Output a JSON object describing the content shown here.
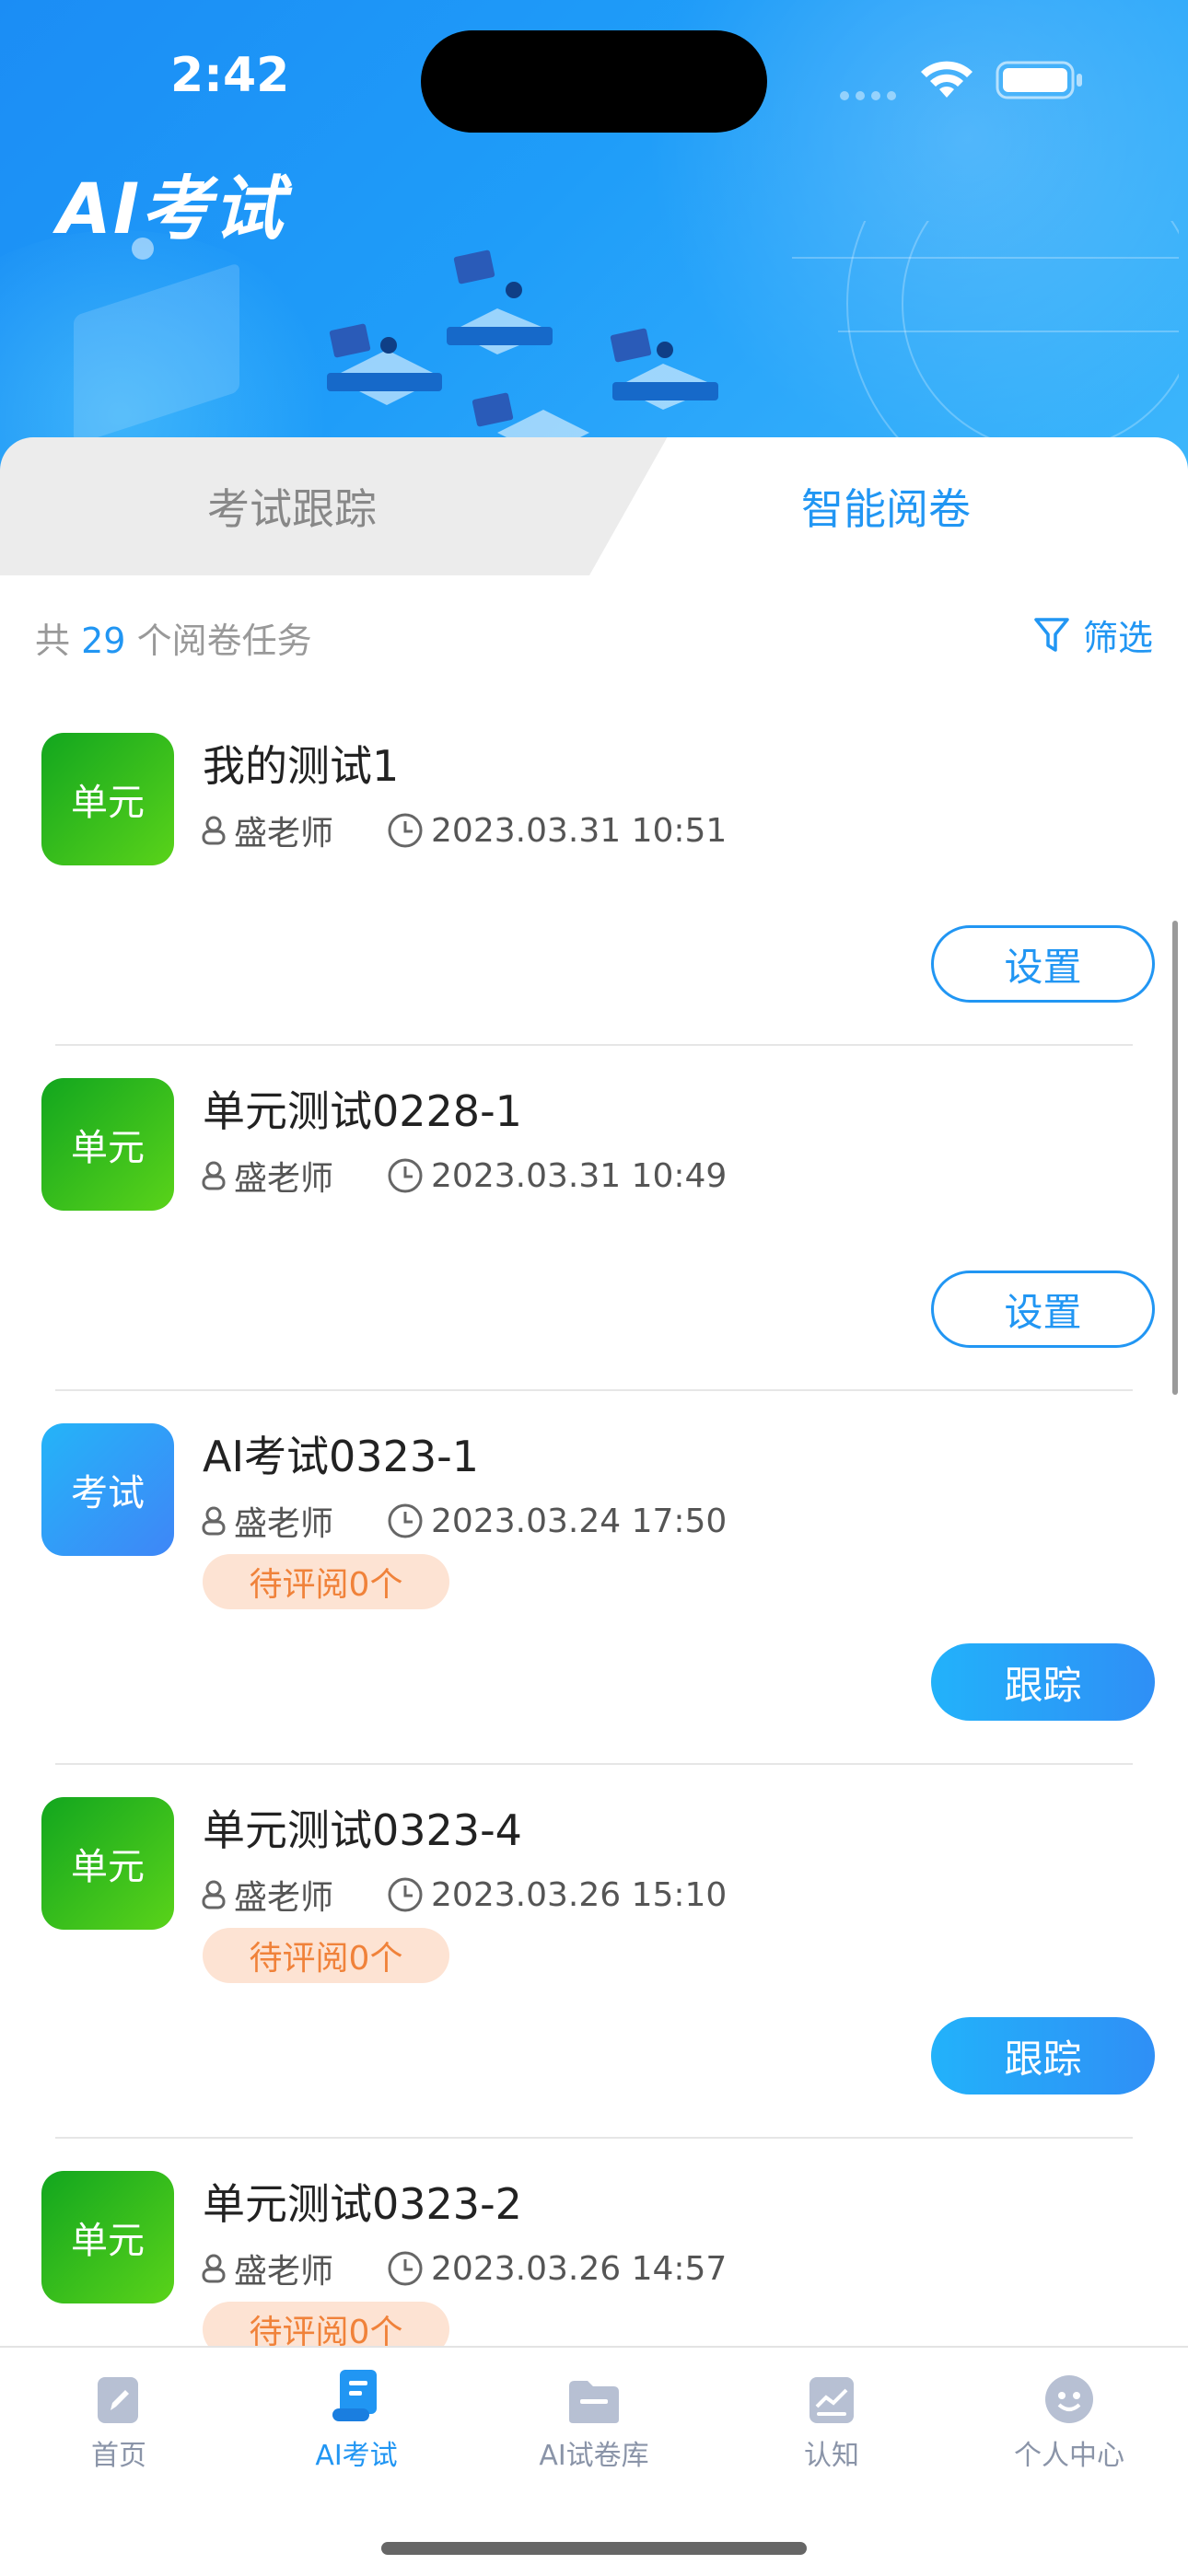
{
  "status_bar": {
    "time": "2:42"
  },
  "header": {
    "title": "AI考试"
  },
  "tabs": [
    {
      "label": "考试跟踪",
      "active": false
    },
    {
      "label": "智能阅卷",
      "active": true
    }
  ],
  "summary": {
    "prefix": "共",
    "count": "29",
    "suffix": "个阅卷任务"
  },
  "filter": {
    "label": "筛选"
  },
  "items": [
    {
      "badge": "单元",
      "badge_type": "unit",
      "title": "我的测试1",
      "teacher": "盛老师",
      "datetime": "2023.03.31 10:51",
      "pending": "",
      "action": "设置",
      "action_style": "outline"
    },
    {
      "badge": "单元",
      "badge_type": "unit",
      "title": "单元测试0228-1",
      "teacher": "盛老师",
      "datetime": "2023.03.31 10:49",
      "pending": "",
      "action": "设置",
      "action_style": "outline"
    },
    {
      "badge": "考试",
      "badge_type": "exam",
      "title": "AI考试0323-1",
      "teacher": "盛老师",
      "datetime": "2023.03.24 17:50",
      "pending": "待评阅0个",
      "action": "跟踪",
      "action_style": "filled"
    },
    {
      "badge": "单元",
      "badge_type": "unit",
      "title": "单元测试0323-4",
      "teacher": "盛老师",
      "datetime": "2023.03.26 15:10",
      "pending": "待评阅0个",
      "action": "跟踪",
      "action_style": "filled"
    },
    {
      "badge": "单元",
      "badge_type": "unit",
      "title": "单元测试0323-2",
      "teacher": "盛老师",
      "datetime": "2023.03.26 14:57",
      "pending": "待评阅0个",
      "action": "",
      "action_style": ""
    }
  ],
  "bottom_nav": [
    {
      "label": "首页",
      "icon": "home-edit-icon",
      "active": false
    },
    {
      "label": "AI考试",
      "icon": "exam-scroll-icon",
      "active": true
    },
    {
      "label": "AI试卷库",
      "icon": "folder-icon",
      "active": false
    },
    {
      "label": "认知",
      "icon": "chart-icon",
      "active": false
    },
    {
      "label": "个人中心",
      "icon": "smiley-icon",
      "active": false
    }
  ],
  "colors": {
    "accent": "#2196f3",
    "unit_badge": "#2cb81c",
    "exam_badge": "#2e9df7",
    "pending_bg": "#fde3d3",
    "pending_text": "#f0823a"
  }
}
